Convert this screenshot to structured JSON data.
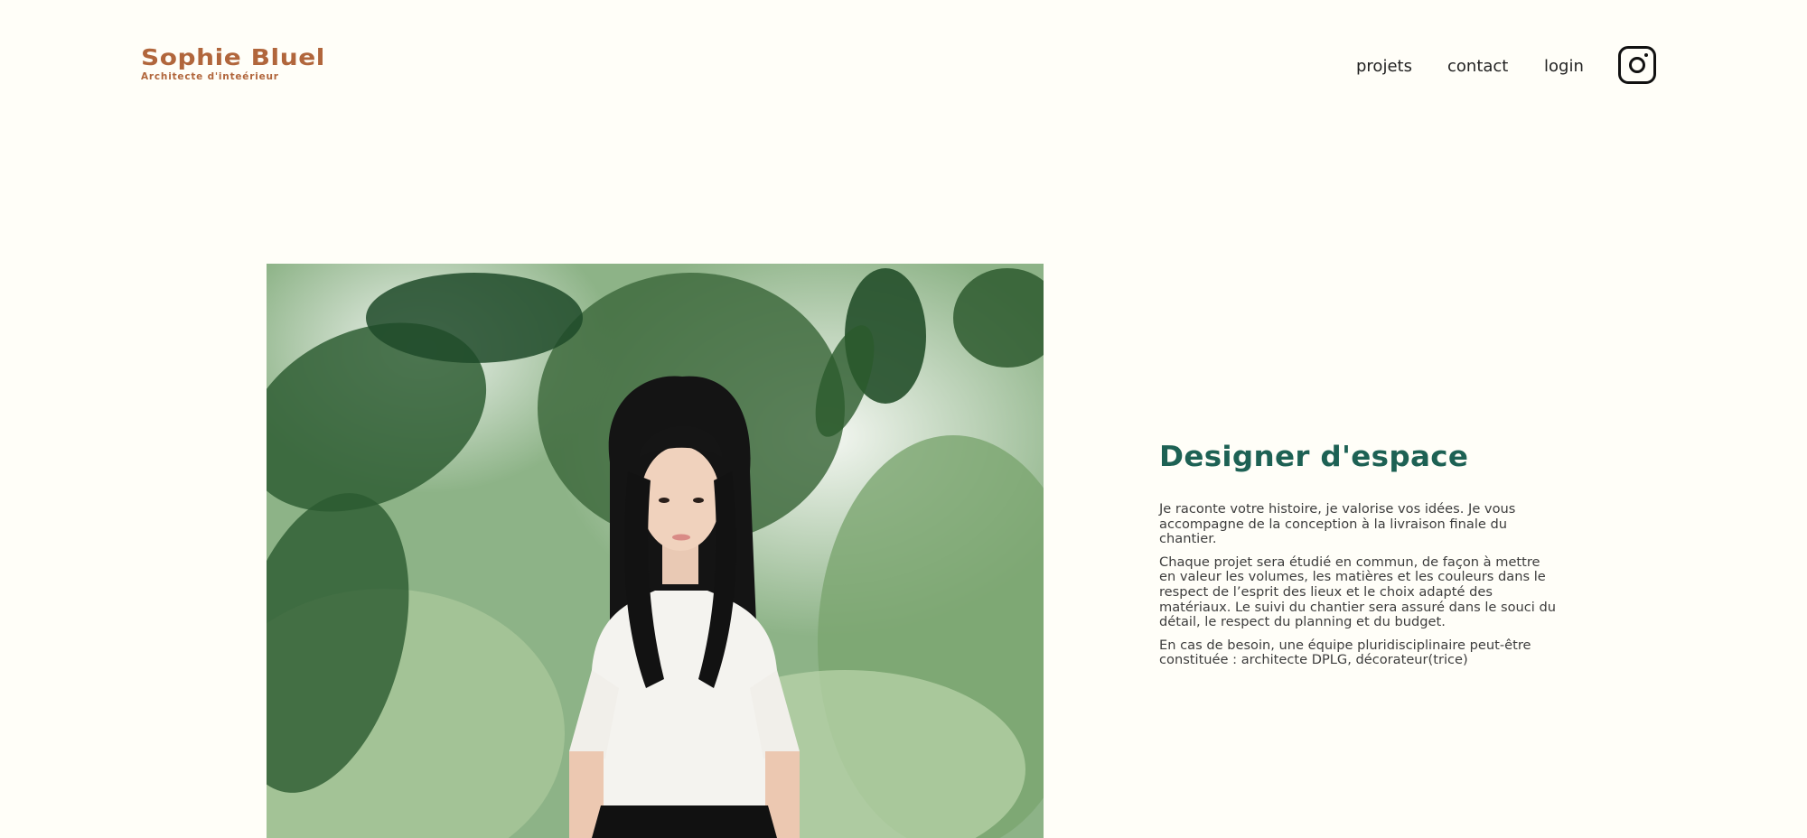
{
  "header": {
    "logo_title": "Sophie Bluel",
    "logo_subtitle": "Architecte d'inteérieur",
    "nav": [
      {
        "label": "projets"
      },
      {
        "label": "contact"
      },
      {
        "label": "login"
      }
    ],
    "instagram_icon": "instagram-icon"
  },
  "intro": {
    "title": "Designer d'espace",
    "paragraphs": [
      "Je raconte votre histoire, je valorise vos idées. Je vous accompagne de la conception à la livraison finale du chantier.",
      "Chaque projet sera étudié en commun, de façon à mettre en valeur les volumes, les matières et les couleurs dans le respect de l’esprit des lieux et le choix adapté des matériaux. Le suivi du chantier sera assuré dans le souci du détail, le respect du planning et du budget.",
      "En cas de besoin, une équipe pluridisciplinaire peut-être constituée : architecte DPLG, décorateur(trice)"
    ]
  },
  "colors": {
    "background": "#FFFEF8",
    "brand": "#B1663C",
    "title": "#1D6154",
    "text": "#3D3D3D"
  }
}
